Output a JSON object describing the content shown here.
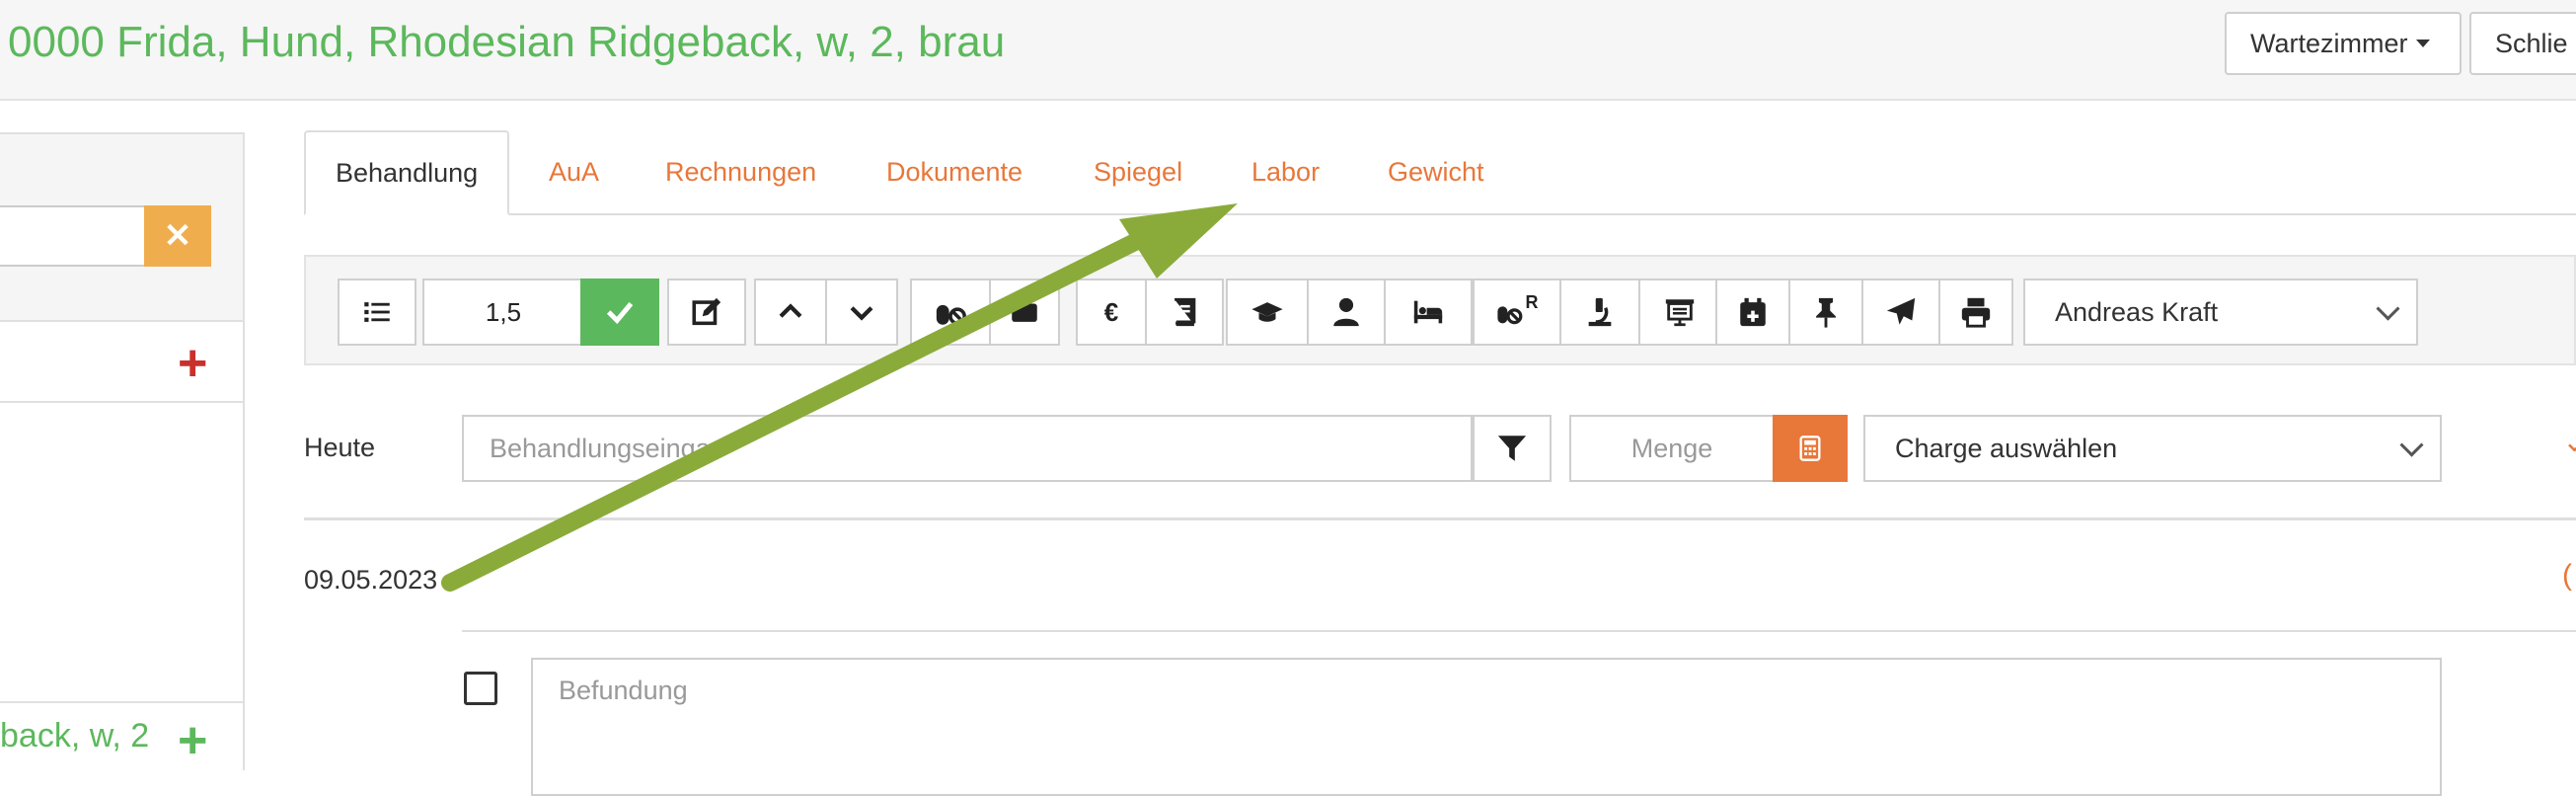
{
  "header": {
    "patient_title": "0000 Frida, Hund, Rhodesian Ridgeback, w, 2, brau",
    "waiting_room_label": "Wartezimmer",
    "close_label": "Schlie"
  },
  "sidebar": {
    "clear_icon": "close-icon",
    "patient_entry": "back, w, 2",
    "add_color_red": "#c9302c",
    "add_color_green": "#5cb85c"
  },
  "tabs": [
    {
      "label": "Behandlung",
      "active": true
    },
    {
      "label": "AuA"
    },
    {
      "label": "Rechnungen"
    },
    {
      "label": "Dokumente"
    },
    {
      "label": "Spiegel"
    },
    {
      "label": "Labor"
    },
    {
      "label": "Gewicht"
    }
  ],
  "toolbar": {
    "factor_value": "1,5",
    "euro_symbol": "€",
    "rx_label": "R",
    "vet_select": "Andreas Kraft",
    "icons": [
      "list-icon",
      "check-icon",
      "edit-icon",
      "chevron-up-icon",
      "chevron-down-icon",
      "pills-icon",
      "card-icon",
      "euro-icon",
      "book-icon",
      "graduation-cap-icon",
      "user-icon",
      "bed-icon",
      "prescription-icon",
      "microscope-icon",
      "presentation-icon",
      "calendar-plus-icon",
      "pin-icon",
      "send-icon",
      "print-icon"
    ]
  },
  "entry": {
    "today_label": "Heute",
    "treatment_placeholder": "Behandlungseingabe",
    "treatment_visible_text": "Behandlungseinga",
    "quantity_placeholder": "Menge",
    "batch_select": "Charge auswählen"
  },
  "history": {
    "date": "09.05.2023",
    "findings_placeholder": "Befundung"
  },
  "annotation": {
    "arrow_color": "#8aab3a",
    "arrow_target": "Labor"
  },
  "colors": {
    "accent_orange": "#e8773a",
    "success_green": "#5cb85c",
    "warning_orange": "#f0ad4e"
  }
}
